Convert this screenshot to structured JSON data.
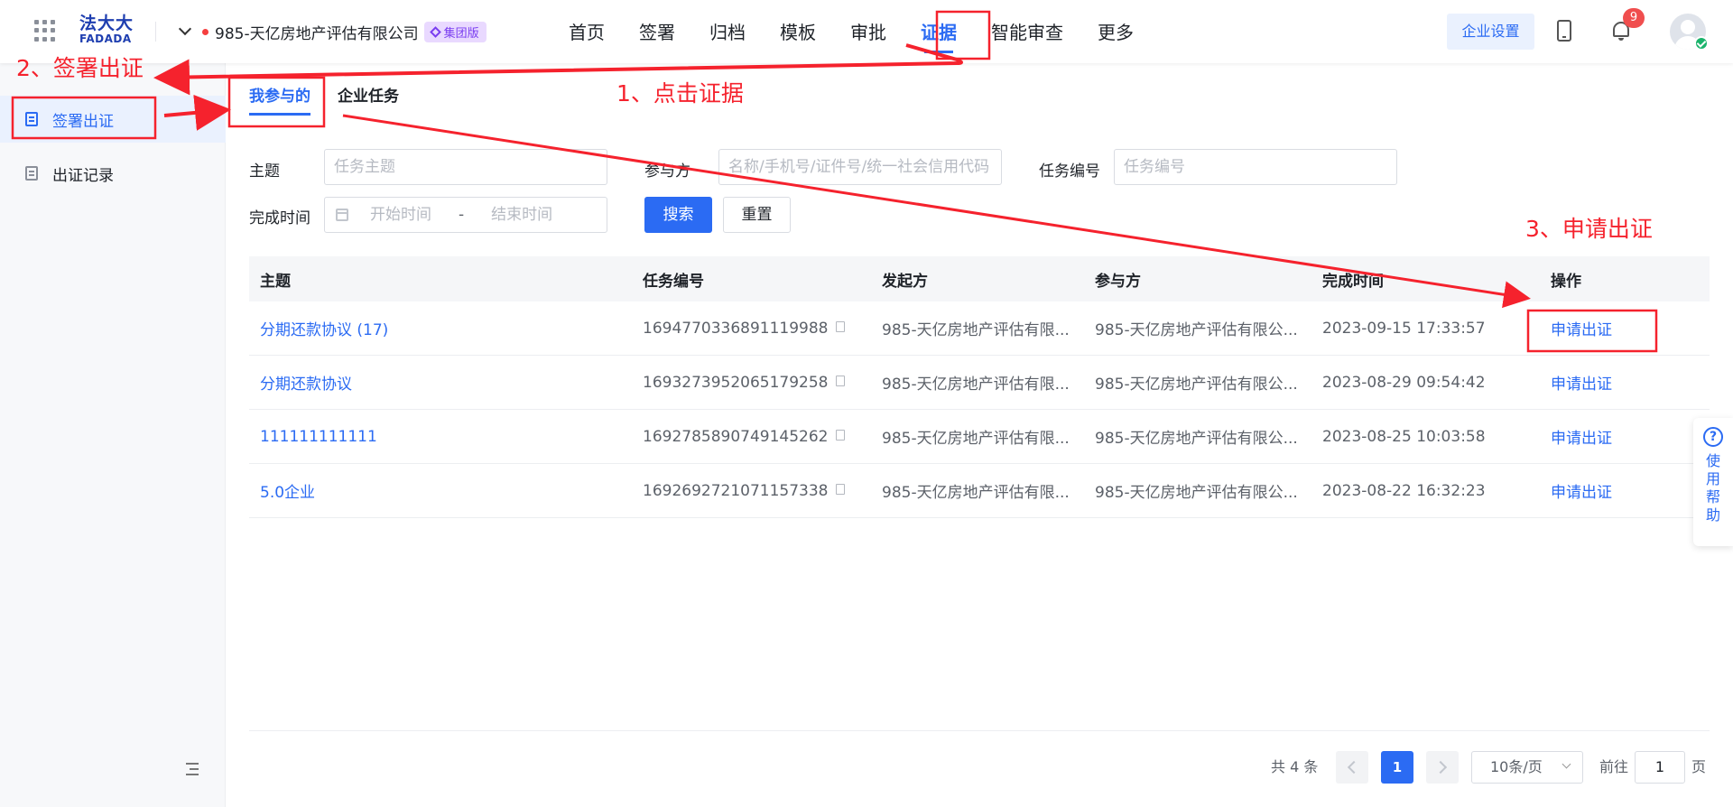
{
  "header": {
    "logo_line1": "法大大",
    "logo_line2": "FADADA",
    "company_name": "985-天亿房地产评估有限公司",
    "edition_badge": "集团版",
    "nav": [
      "首页",
      "签署",
      "归档",
      "模板",
      "审批",
      "证据",
      "智能审查",
      "更多"
    ],
    "active_nav": "证据",
    "enterprise_settings": "企业设置",
    "notification_count": "9"
  },
  "sidebar": {
    "items": [
      "签署出证",
      "出证记录"
    ],
    "active": "签署出证"
  },
  "tabs": [
    "我参与的",
    "企业任务"
  ],
  "filters": {
    "subject_label": "主题",
    "subject_placeholder": "任务主题",
    "participant_label": "参与方",
    "participant_placeholder": "名称/手机号/证件号/统一社会信用代码",
    "task_no_label": "任务编号",
    "task_no_placeholder": "任务编号",
    "finish_time_label": "完成时间",
    "start_placeholder": "开始时间",
    "range_sep": "-",
    "end_placeholder": "结束时间",
    "search_button": "搜索",
    "reset_button": "重置"
  },
  "table": {
    "columns": [
      "主题",
      "任务编号",
      "发起方",
      "参与方",
      "完成时间",
      "操作"
    ],
    "rows": [
      {
        "subject": "分期还款协议 (17)",
        "task_no": "1694770336891119988",
        "initiator": "985-天亿房地产评估有限...",
        "participant": "985-天亿房地产评估有限公...",
        "finish_time": "2023-09-15 17:33:57",
        "action": "申请出证"
      },
      {
        "subject": "分期还款协议",
        "task_no": "1693273952065179258",
        "initiator": "985-天亿房地产评估有限...",
        "participant": "985-天亿房地产评估有限公...",
        "finish_time": "2023-08-29 09:54:42",
        "action": "申请出证"
      },
      {
        "subject": "111111111111",
        "task_no": "1692785890749145262",
        "initiator": "985-天亿房地产评估有限...",
        "participant": "985-天亿房地产评估有限公...",
        "finish_time": "2023-08-25 10:03:58",
        "action": "申请出证"
      },
      {
        "subject": "5.0企业",
        "task_no": "1692692721071157338",
        "initiator": "985-天亿房地产评估有限...",
        "participant": "985-天亿房地产评估有限公...",
        "finish_time": "2023-08-22 16:32:23",
        "action": "申请出证"
      }
    ]
  },
  "pagination": {
    "total": "共 4 条",
    "current_page": "1",
    "page_size": "10条/页",
    "goto_label": "前往",
    "goto_value": "1",
    "page_unit": "页"
  },
  "help": {
    "label": "使用帮助"
  },
  "annotations": {
    "step1": "1、点击证据",
    "step2": "2、签署出证",
    "step3": "3、申请出证"
  },
  "colors": {
    "primary": "#2b6bf3",
    "annotation": "#f5222d",
    "badge": "#f04e4e"
  }
}
